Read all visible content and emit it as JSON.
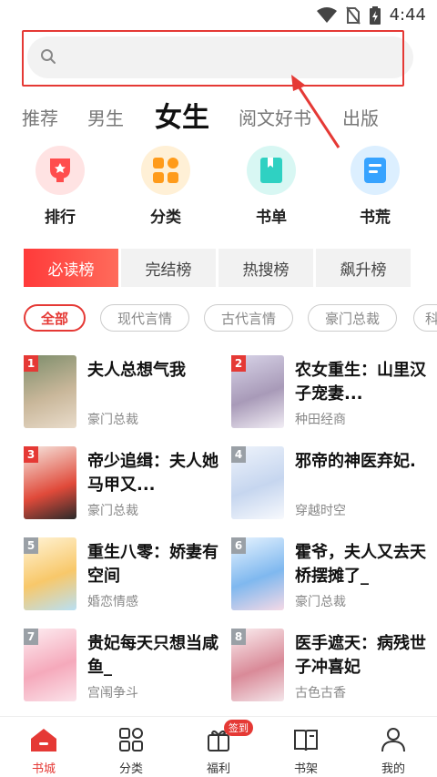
{
  "status": {
    "time": "4:44"
  },
  "search": {
    "placeholder": ""
  },
  "categories": [
    {
      "label": "推荐"
    },
    {
      "label": "男生"
    },
    {
      "label": "女生"
    },
    {
      "label": "阅文好书"
    },
    {
      "label": "出版"
    }
  ],
  "quick_links": [
    {
      "label": "排行",
      "icon": "trophy-icon",
      "color": "#ff4d4d"
    },
    {
      "label": "分类",
      "icon": "grid-icon",
      "color": "#ff9b1a"
    },
    {
      "label": "书单",
      "icon": "book-icon",
      "color": "#2fd1c2"
    },
    {
      "label": "书荒",
      "icon": "note-icon",
      "color": "#37a3ff"
    }
  ],
  "rank_tabs": [
    {
      "label": "必读榜"
    },
    {
      "label": "完结榜"
    },
    {
      "label": "热搜榜"
    },
    {
      "label": "飙升榜"
    }
  ],
  "chips": [
    {
      "label": "全部"
    },
    {
      "label": "现代言情"
    },
    {
      "label": "古代言情"
    },
    {
      "label": "豪门总裁"
    },
    {
      "label": "科"
    }
  ],
  "books": [
    {
      "rank": "1",
      "title": "夫人总想气我",
      "genre": "豪门总裁"
    },
    {
      "rank": "2",
      "title": "农女重生：山里汉子宠妻...",
      "genre": "种田经商"
    },
    {
      "rank": "3",
      "title": "帝少追缉：夫人她马甲又...",
      "genre": "豪门总裁"
    },
    {
      "rank": "4",
      "title": "邪帝的神医弃妃.",
      "genre": "穿越时空"
    },
    {
      "rank": "5",
      "title": "重生八零：娇妻有空间",
      "genre": "婚恋情感"
    },
    {
      "rank": "6",
      "title": "霍爷，夫人又去天桥摆摊了_",
      "genre": "豪门总裁"
    },
    {
      "rank": "7",
      "title": "贵妃每天只想当咸鱼_",
      "genre": "宫闱争斗"
    },
    {
      "rank": "8",
      "title": "医手遮天：病残世子冲喜妃",
      "genre": "古色古香"
    }
  ],
  "bottom_nav": [
    {
      "label": "书城",
      "icon": "home-icon"
    },
    {
      "label": "分类",
      "icon": "category-icon"
    },
    {
      "label": "福利",
      "icon": "gift-icon"
    },
    {
      "label": "书架",
      "icon": "bookshelf-icon"
    },
    {
      "label": "我的",
      "icon": "profile-icon"
    }
  ],
  "welfare_badge": "签到",
  "colors": {
    "accent": "#e53935"
  }
}
